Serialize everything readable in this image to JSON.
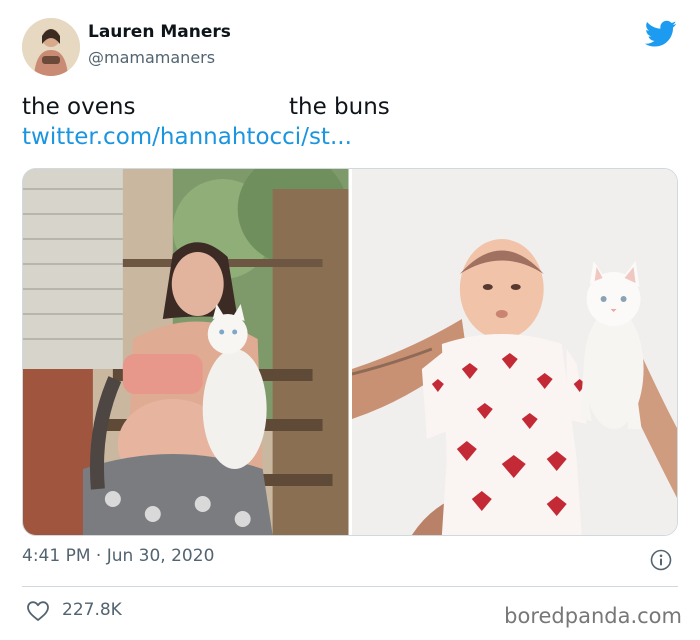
{
  "author": {
    "name": "Lauren Maners",
    "handle": "@mamamaners",
    "avatar_icon": "profile-photo"
  },
  "tweet": {
    "text": "the ovens                     the buns",
    "link": "twitter.com/hannahtocci/st..."
  },
  "media": {
    "photos": [
      {
        "name": "pregnant-woman-holding-white-cat-photo"
      },
      {
        "name": "newborn-baby-holding-white-kitten-photo"
      }
    ]
  },
  "meta": {
    "timestamp": "4:41 PM · Jun 30, 2020",
    "likes": "227.8K"
  },
  "icons": {
    "brand": "twitter-bird-icon",
    "info": "info-icon",
    "like": "heart-icon"
  },
  "colors": {
    "link": "#1b95e0",
    "twitter_blue": "#1d9bf0",
    "secondary_text": "#536471"
  },
  "watermark": "boredpanda.com"
}
